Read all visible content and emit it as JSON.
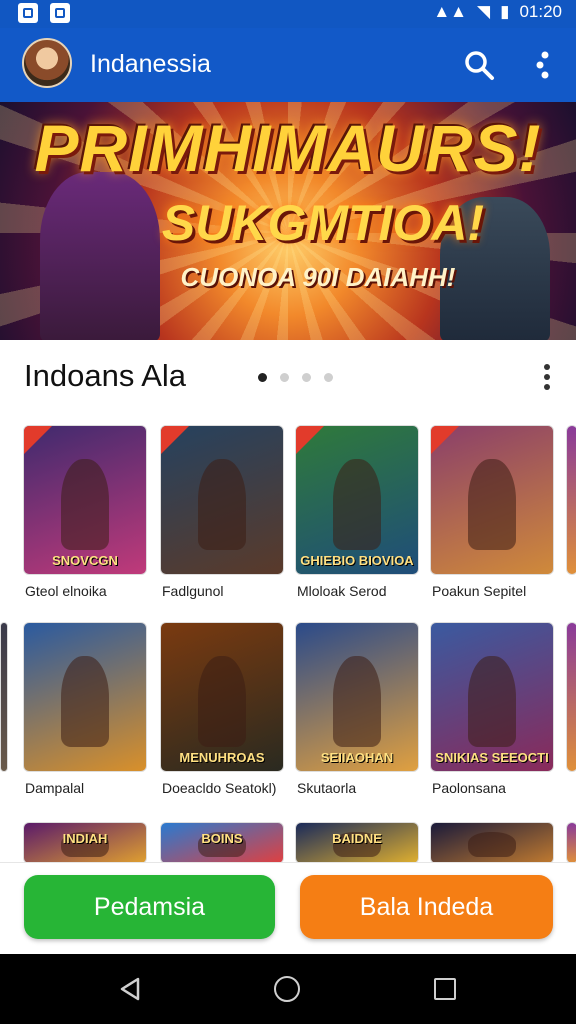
{
  "status_bar": {
    "time": "01:20"
  },
  "app_bar": {
    "title": "Indanessia",
    "search_icon": "search-icon",
    "menu_icon": "more-vert-icon"
  },
  "banner": {
    "line1": "PRIMHIMAURS!",
    "line2": "SUKGMTIOA!",
    "line3": "CUONOA 90I DAIAHH!"
  },
  "section": {
    "title": "Indoans Ala",
    "pager_total": 4,
    "pager_active": 0
  },
  "games": [
    {
      "label": "Gteol elnoika",
      "cover_text": "SNOVCGN",
      "colors": [
        "#3f2a6e",
        "#c03a7a"
      ]
    },
    {
      "label": "Fadlgunol",
      "cover_text": "",
      "colors": [
        "#26425f",
        "#5a3a2a"
      ]
    },
    {
      "label": "Mloloak Serod",
      "cover_text": "GHIEBIO BIOVIOA",
      "colors": [
        "#2f7a3a",
        "#1f4d7a"
      ]
    },
    {
      "label": "Poakun Sepitel",
      "cover_text": "",
      "colors": [
        "#8a3f6a",
        "#d08a3a"
      ]
    },
    {
      "label": "Dampalal",
      "cover_text": "",
      "colors": [
        "#2a5aa0",
        "#d9902a"
      ]
    },
    {
      "label": "Doeacldo Seatokl)",
      "cover_text": "MENUHROAS",
      "colors": [
        "#7a3a10",
        "#2a2a20"
      ]
    },
    {
      "label": "Skutaorla",
      "cover_text": "SEIIAOHAN",
      "colors": [
        "#2a4a8a",
        "#e0a040"
      ]
    },
    {
      "label": "Paolonsana",
      "cover_text": "SNIKIAS SEEOCTI",
      "colors": [
        "#3a5aa0",
        "#8a2a5a"
      ]
    },
    {
      "label": "",
      "cover_text": "INDIAH",
      "colors": [
        "#5a1a6a",
        "#e0a030"
      ]
    },
    {
      "label": "",
      "cover_text": "BOINS",
      "colors": [
        "#2a7ad0",
        "#e04040"
      ]
    },
    {
      "label": "",
      "cover_text": "BAIDNE",
      "colors": [
        "#1a2a5a",
        "#e0b030"
      ]
    },
    {
      "label": "",
      "cover_text": "",
      "colors": [
        "#1a1a3a",
        "#c07a30"
      ]
    }
  ],
  "buttons": {
    "primary": "Pedamsia",
    "secondary": "Bala Indeda"
  },
  "nav": {
    "back_icon": "back-icon",
    "home_icon": "home-icon",
    "recent_icon": "recents-icon"
  }
}
